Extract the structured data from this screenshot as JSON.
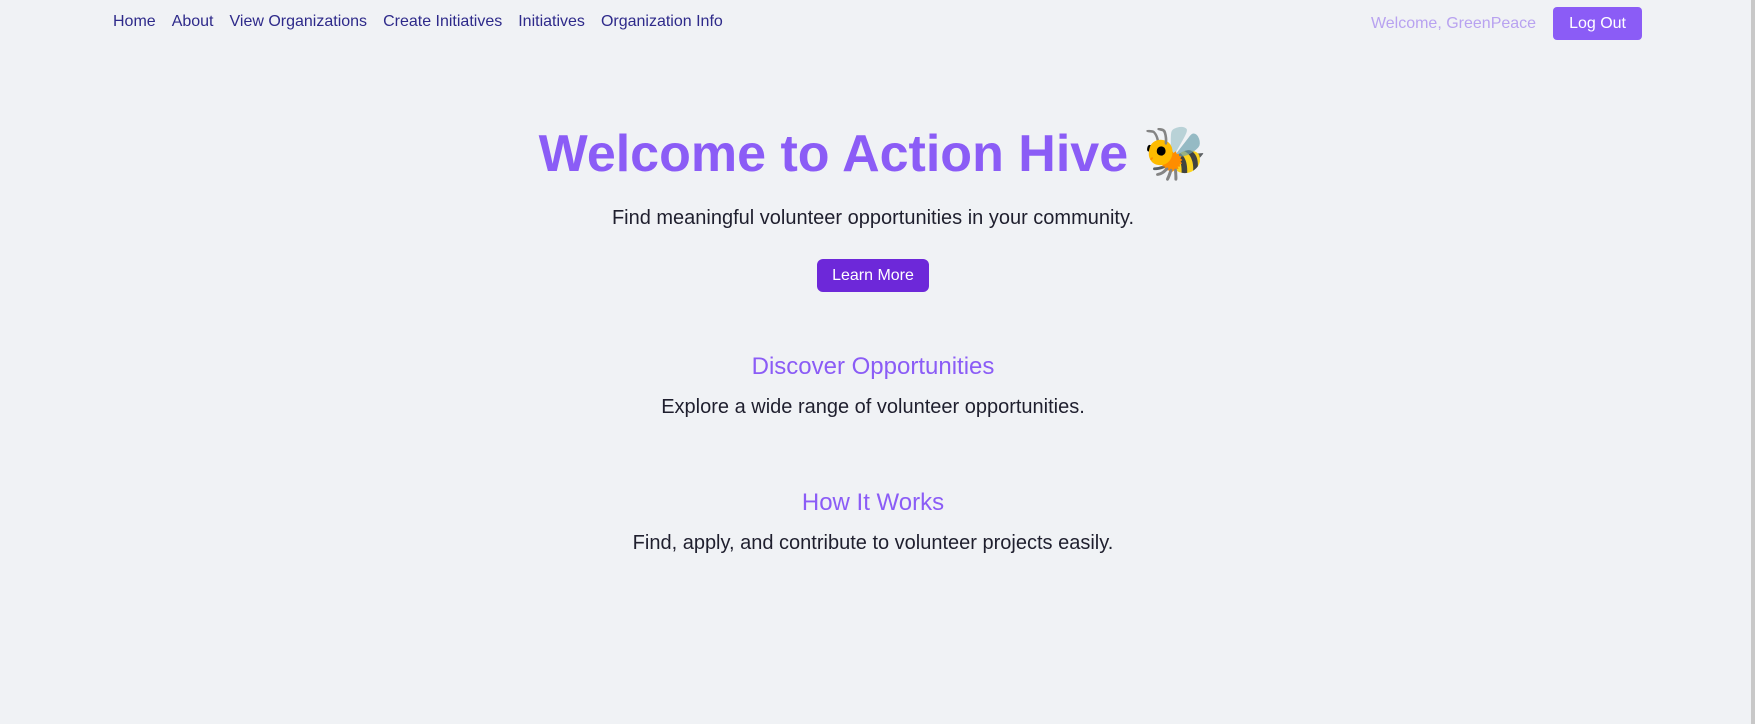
{
  "nav": {
    "links": [
      {
        "label": "Home"
      },
      {
        "label": "About"
      },
      {
        "label": "View Organizations"
      },
      {
        "label": "Create Initiatives"
      },
      {
        "label": "Initiatives"
      },
      {
        "label": "Organization Info"
      }
    ],
    "welcome_text": "Welcome, GreenPeace",
    "logout_label": "Log Out"
  },
  "hero": {
    "title": "Welcome to Action Hive",
    "title_icon": "🐝",
    "subtitle": "Find meaningful volunteer opportunities in your community.",
    "button_label": "Learn More"
  },
  "sections": [
    {
      "title": "Discover Opportunities",
      "text": "Explore a wide range of volunteer opportunities."
    },
    {
      "title": "How It Works",
      "text": "Find, apply, and contribute to volunteer projects easily."
    }
  ],
  "colors": {
    "background": "#f0f2f5",
    "accent": "#8b5cf6",
    "nav_link": "#2e2a8a",
    "learn_more_button": "#6d28d9"
  }
}
